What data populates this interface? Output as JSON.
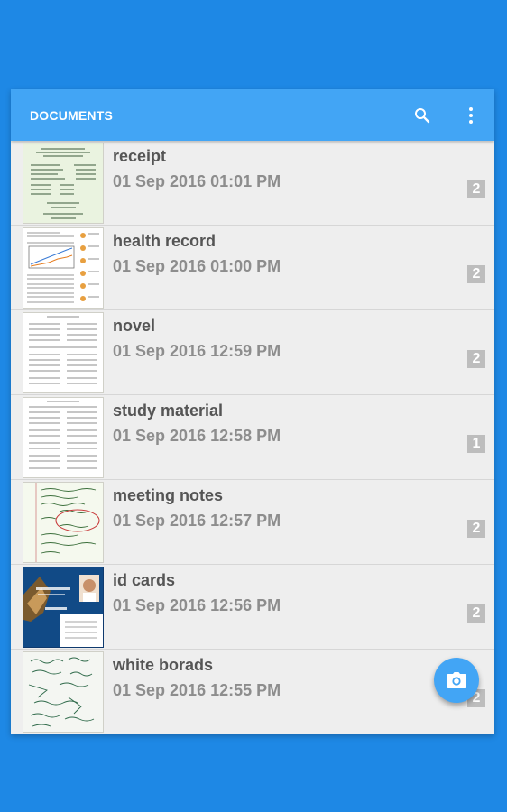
{
  "appbar": {
    "title": "DOCUMENTS",
    "search_icon": "search-icon",
    "menu_icon": "more-vert-icon"
  },
  "documents": [
    {
      "title": "receipt",
      "date": "01 Sep 2016 01:01 PM",
      "pages": "2",
      "thumb": "receipt-thumbnail"
    },
    {
      "title": "health record",
      "date": "01 Sep 2016 01:00 PM",
      "pages": "2",
      "thumb": "health-record-thumbnail"
    },
    {
      "title": "novel",
      "date": "01 Sep 2016 12:59 PM",
      "pages": "2",
      "thumb": "novel-thumbnail"
    },
    {
      "title": "study material",
      "date": "01 Sep 2016 12:58 PM",
      "pages": "1",
      "thumb": "study-material-thumbnail"
    },
    {
      "title": "meeting notes",
      "date": "01 Sep 2016 12:57 PM",
      "pages": "2",
      "thumb": "meeting-notes-thumbnail"
    },
    {
      "title": "id cards",
      "date": "01 Sep 2016 12:56 PM",
      "pages": "2",
      "thumb": "id-card-thumbnail"
    },
    {
      "title": "white borads",
      "date": "01 Sep 2016 12:55 PM",
      "pages": "2",
      "thumb": "whiteboard-thumbnail"
    }
  ],
  "fab": {
    "icon": "camera-icon"
  },
  "colors": {
    "background": "#1e88e5",
    "appbar": "#42a5f5",
    "list_bg": "#eeeeee",
    "title_text": "#555555",
    "date_text": "#8d8d8d",
    "badge": "#bdbdbd"
  }
}
